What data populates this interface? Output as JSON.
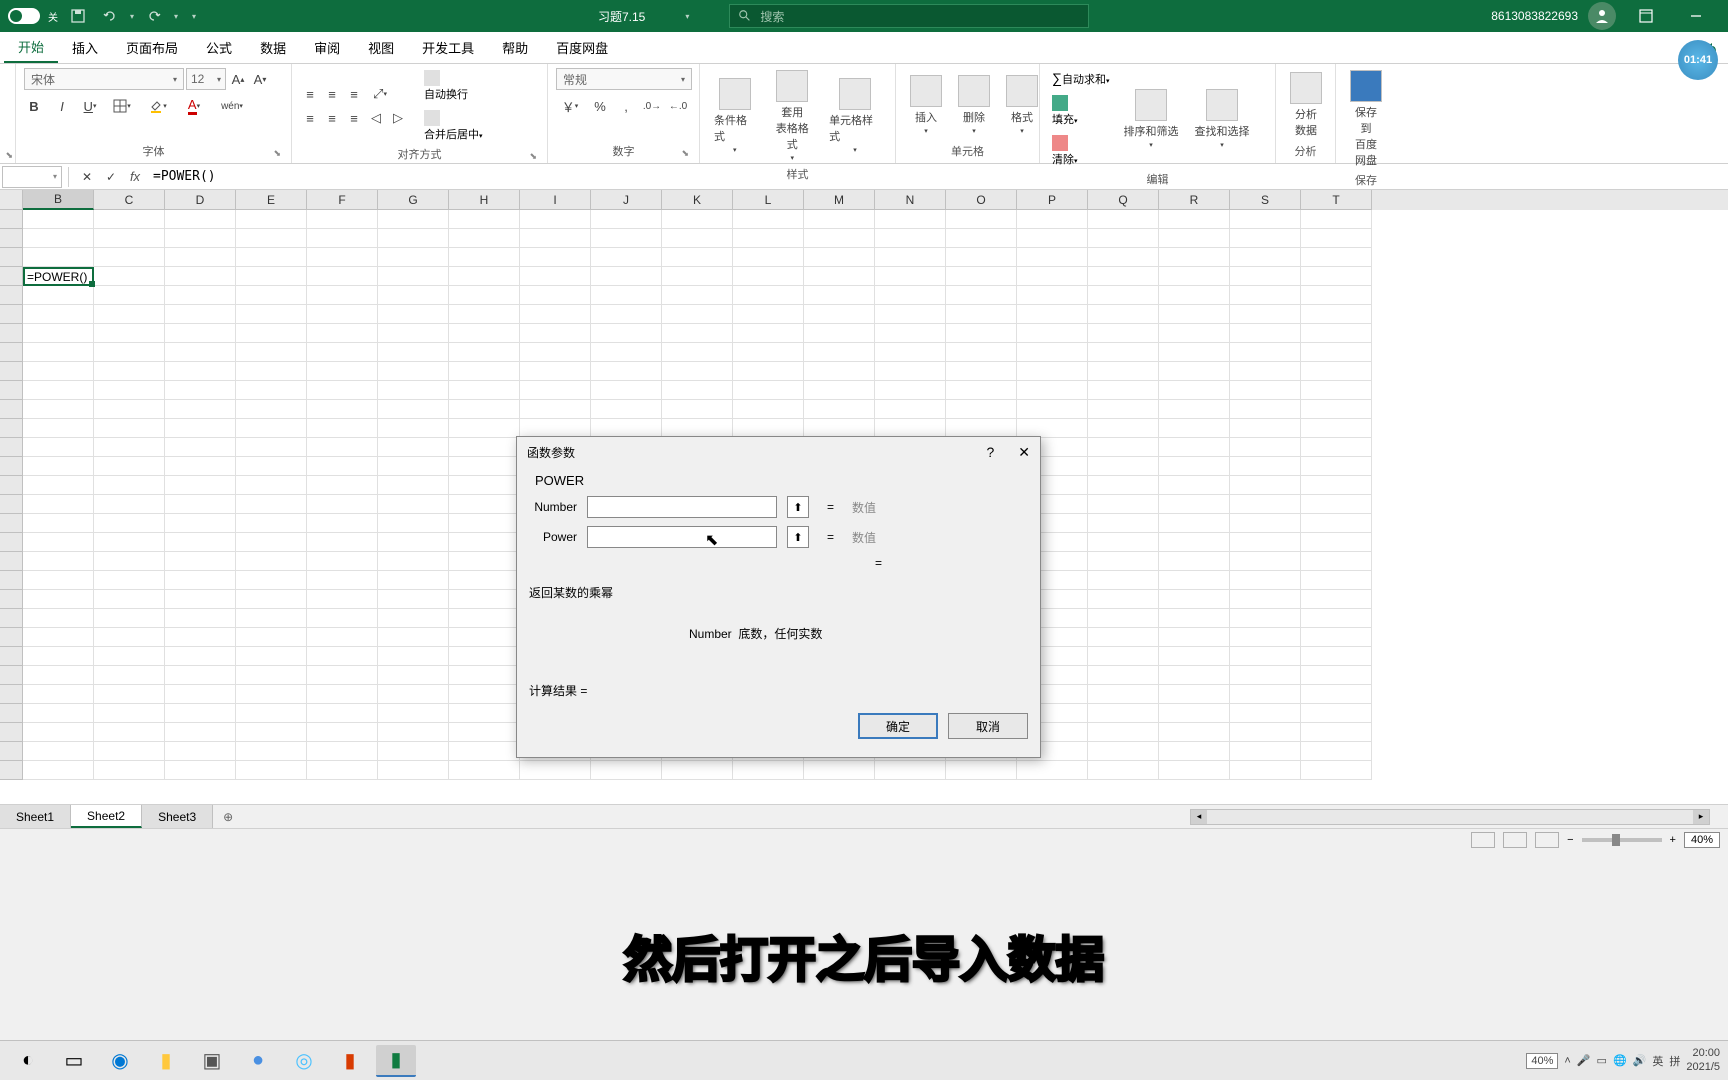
{
  "titlebar": {
    "toggle_label": "关",
    "doc_title": "习题7.15",
    "search_placeholder": "搜索",
    "user_id": "8613083822693"
  },
  "tabs": {
    "items": [
      "开始",
      "插入",
      "页面布局",
      "公式",
      "数据",
      "审阅",
      "视图",
      "开发工具",
      "帮助",
      "百度网盘"
    ],
    "active_index": 0
  },
  "ribbon": {
    "font_name": "宋体",
    "font_size": "12",
    "font_group": "字体",
    "align_group": "对齐方式",
    "wrap": "自动换行",
    "merge": "合并后居中",
    "number_format": "常规",
    "number_group": "数字",
    "cond_fmt": "条件格式",
    "table_fmt": "套用\n表格格式",
    "cell_style": "单元格样式",
    "style_group": "样式",
    "insert": "插入",
    "delete": "删除",
    "format": "格式",
    "cells_group": "单元格",
    "autosum": "自动求和",
    "fill": "填充",
    "clear": "清除",
    "sort_filter": "排序和筛选",
    "find_select": "查找和选择",
    "edit_group": "编辑",
    "analyze": "分析\n数据",
    "analyze_group": "分析",
    "save": "保存到\n百度网盘",
    "save_group": "保存"
  },
  "formula_bar": {
    "name_box": "",
    "formula": "=POWER()"
  },
  "grid": {
    "columns": [
      "B",
      "C",
      "D",
      "E",
      "F",
      "G",
      "H",
      "I",
      "J",
      "K",
      "L",
      "M",
      "N",
      "O",
      "P",
      "Q",
      "R",
      "S",
      "T"
    ],
    "active_cell_value": "=POWER()"
  },
  "dialog": {
    "title": "函数参数",
    "func_name": "POWER",
    "arg1_label": "Number",
    "arg2_label": "Power",
    "val_placeholder": "数值",
    "eq": "=",
    "desc": "返回某数的乘幂",
    "arg_desc_label": "Number",
    "arg_desc_text": "底数，任何实数",
    "result_label": "计算结果 =",
    "ok": "确定",
    "cancel": "取消"
  },
  "sheets": {
    "items": [
      "Sheet1",
      "Sheet2",
      "Sheet3"
    ],
    "active_index": 1
  },
  "status": {
    "zoom": "40%"
  },
  "timer": "01:41",
  "subtitle": "然后打开之后导入数据",
  "taskbar": {
    "battery": "",
    "lang": "英",
    "ime": "拼",
    "time": "20:00",
    "date": "2021/5"
  }
}
